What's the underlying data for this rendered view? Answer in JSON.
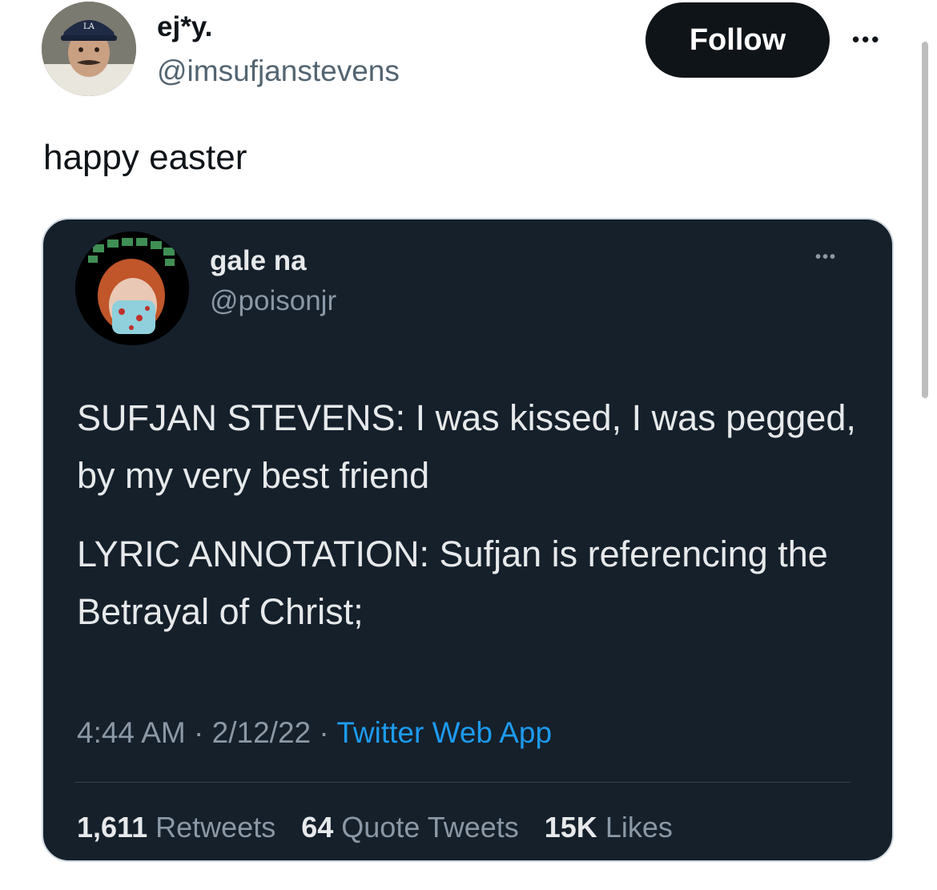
{
  "author": {
    "name": "ej*y.",
    "handle": "@imsufjanstevens"
  },
  "follow_label": "Follow",
  "more_label": "•••",
  "tweet_text": "happy easter",
  "quoted": {
    "name": "gale na",
    "handle": "@poisonjr",
    "more_label": "•••",
    "paragraphs": [
      "SUFJAN STEVENS: I was kissed, I was pegged, by my very best friend",
      "LYRIC ANNOTATION: Sufjan is referencing the Betrayal of Christ;"
    ],
    "time": "4:44 AM",
    "date": "2/12/22",
    "separator": "·",
    "app": "Twitter Web App",
    "stats": {
      "retweets_count": "1,611",
      "retweets_label": "Retweets",
      "quotes_count": "64",
      "quotes_label": "Quote Tweets",
      "likes_count": "15K",
      "likes_label": "Likes"
    }
  },
  "colors": {
    "card_bg": "#15202b",
    "link_blue": "#1d9bf0",
    "follow_bg": "#0f1419"
  }
}
